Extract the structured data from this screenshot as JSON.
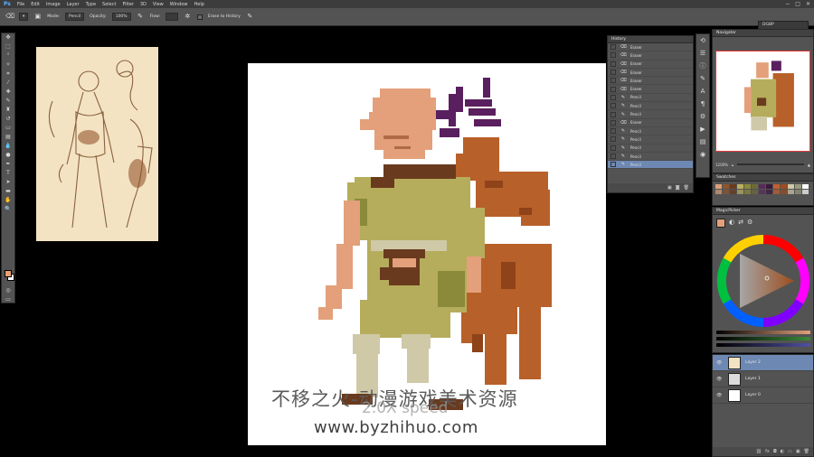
{
  "menubar": {
    "app_logo": "Ps",
    "items": [
      "File",
      "Edit",
      "Image",
      "Layer",
      "Type",
      "Select",
      "Filter",
      "3D",
      "View",
      "Window",
      "Help"
    ],
    "window_controls": [
      "−",
      "□",
      "✕"
    ]
  },
  "options": {
    "mode_label": "Mode:",
    "mode_value": "Pencil",
    "opacity_label": "Opacity:",
    "opacity_value": "100%",
    "flow_label": "Flow:",
    "erase_history_label": "Erase to History",
    "workspace": "DGBP"
  },
  "history": {
    "title": "History",
    "entries": [
      "Eraser",
      "Eraser",
      "Eraser",
      "Eraser",
      "Eraser",
      "Eraser",
      "Pencil",
      "Pencil",
      "Pencil",
      "Eraser",
      "Pencil",
      "Pencil",
      "Pencil",
      "Pencil",
      "Pencil"
    ],
    "selected_index": 14
  },
  "navigator": {
    "title": "Navigator",
    "zoom": "1200%"
  },
  "swatches": {
    "title": "Swatches",
    "colors": [
      "#d9a079",
      "#8a5630",
      "#6a3a1e",
      "#b8b060",
      "#8b8a3a",
      "#6e6a3a",
      "#5a2a5a",
      "#3a1a3a",
      "#c06030",
      "#a04a1e",
      "#cfc9a8",
      "#9a9a80",
      "#ffffff"
    ]
  },
  "magicpicker": {
    "title": "MagicPicker"
  },
  "layers": {
    "items": [
      {
        "name": "Layer 2",
        "selected": true
      },
      {
        "name": "Layer 1",
        "selected": false
      },
      {
        "name": "Layer 0",
        "selected": false
      }
    ]
  },
  "watermark": {
    "chinese": "不移之火-动漫游戏美术资源",
    "speed": "2.0X speed",
    "url": "www.byzhihuo.com"
  },
  "colors": {
    "skin": "#e3a07a",
    "tunic": "#b5ad5c",
    "belt": "#6a3a1e",
    "hair": "#5a1f5f",
    "creature": "#b8602a",
    "accent_selection": "#6d88b2"
  }
}
